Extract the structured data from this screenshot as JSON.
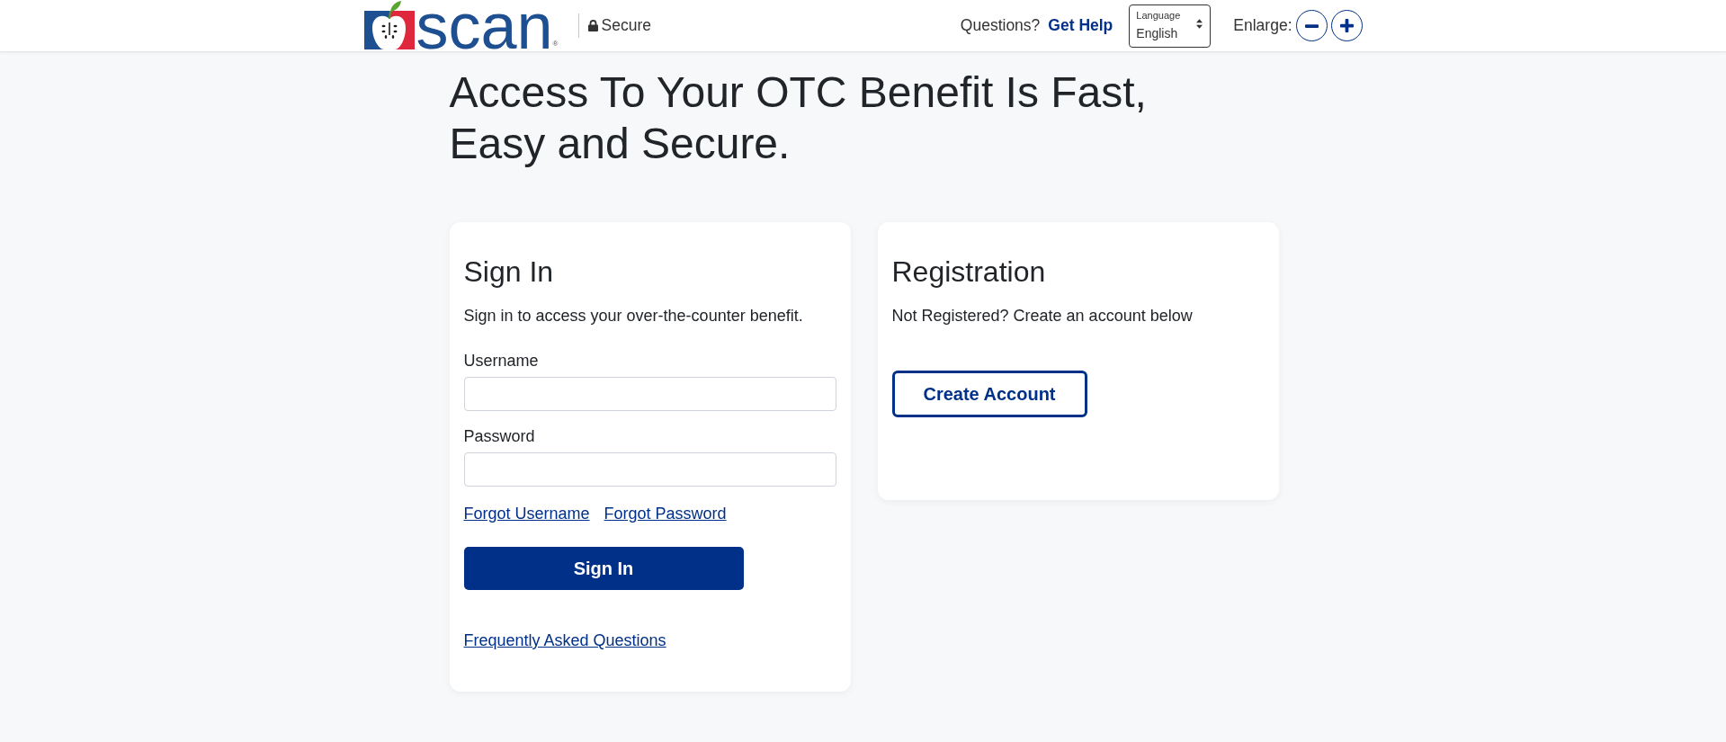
{
  "header": {
    "logo": {
      "wordmark": "scan",
      "registered_mark": "®"
    },
    "security": {
      "label": "Secure"
    },
    "help": {
      "prompt": "Questions?",
      "link": "Get Help"
    },
    "language": {
      "label": "Language",
      "value": "English"
    },
    "enlarge": {
      "label": "Enlarge:",
      "buttons": [
        {
          "kind": "decrease"
        },
        {
          "kind": "increase"
        }
      ]
    }
  },
  "headline": "Access To Your OTC Benefit Is Fast, Easy and Secure.",
  "cards": [
    {
      "title": "Sign In",
      "description": "Sign in to access your over-the-counter benefit.",
      "fields": [
        {
          "label": "Username"
        },
        {
          "label": "Password"
        }
      ],
      "links": [
        "Forgot Username",
        "Forgot Password"
      ],
      "button": {
        "label": "Sign In",
        "kind": "primary"
      },
      "footer_link": "Frequently Asked Questions"
    },
    {
      "title": "Registration",
      "description": "Not Registered? Create an account below",
      "button": {
        "label": "Create Account",
        "kind": "secondary"
      }
    }
  ]
}
